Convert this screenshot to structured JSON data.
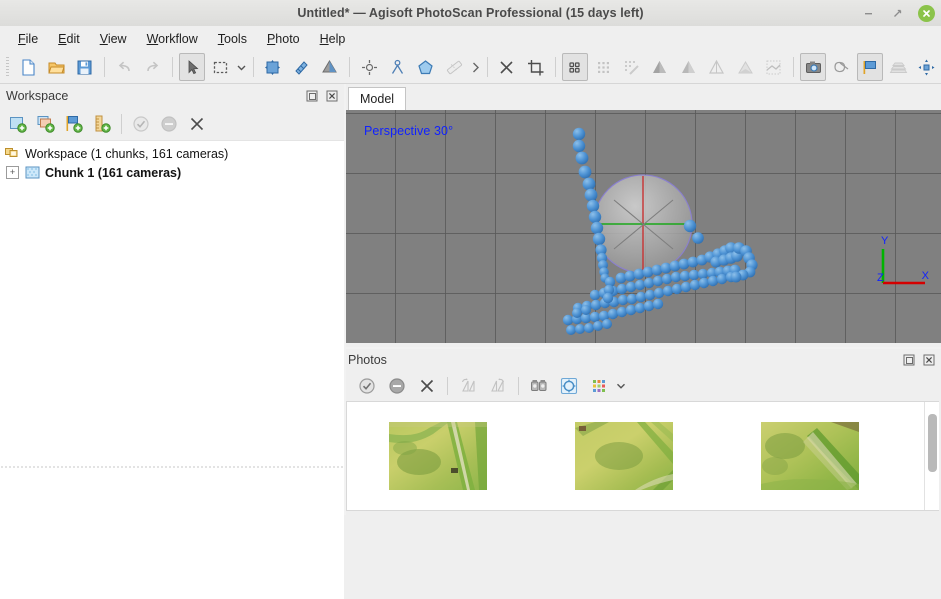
{
  "window": {
    "title": "Untitled* — Agisoft PhotoScan Professional (15 days left)",
    "minimize_label": "–",
    "restore_label": "⇱",
    "close_label": "×",
    "close_color": "#8bc34a"
  },
  "menubar": {
    "items": [
      {
        "label": "File",
        "accel": "F"
      },
      {
        "label": "Edit",
        "accel": "E"
      },
      {
        "label": "View",
        "accel": "V"
      },
      {
        "label": "Workflow",
        "accel": "W"
      },
      {
        "label": "Tools",
        "accel": "T"
      },
      {
        "label": "Photo",
        "accel": "P"
      },
      {
        "label": "Help",
        "accel": "H"
      }
    ]
  },
  "toolbar": {
    "groups": [
      {
        "name": "file",
        "buttons": [
          {
            "icon": "new-document-icon",
            "label": "New",
            "state": "enabled"
          },
          {
            "icon": "open-folder-icon",
            "label": "Open",
            "state": "enabled"
          },
          {
            "icon": "save-disk-icon",
            "label": "Save",
            "state": "enabled"
          }
        ]
      },
      {
        "name": "history",
        "buttons": [
          {
            "icon": "undo-arrow-icon",
            "label": "Undo",
            "state": "disabled"
          },
          {
            "icon": "redo-arrow-icon",
            "label": "Redo",
            "state": "disabled"
          }
        ]
      },
      {
        "name": "selection",
        "buttons": [
          {
            "icon": "cursor-arrow-icon",
            "label": "Navigation",
            "state": "active"
          },
          {
            "icon": "rectangle-selection-icon",
            "label": "Rectangle Selection",
            "state": "enabled"
          },
          {
            "icon": "chevron-down-icon",
            "label": "Selection Tools",
            "state": "enabled"
          }
        ]
      },
      {
        "name": "transform",
        "buttons": [
          {
            "icon": "move-object-icon",
            "label": "Move Object",
            "state": "enabled"
          },
          {
            "icon": "rotate-object-icon",
            "label": "Rotate Object",
            "state": "enabled"
          },
          {
            "icon": "scale-object-icon",
            "label": "Scale Object",
            "state": "enabled"
          }
        ]
      },
      {
        "name": "markers",
        "buttons": [
          {
            "icon": "add-point-icon",
            "label": "Add Point",
            "state": "enabled"
          },
          {
            "icon": "add-marker-icon",
            "label": "Add Marker",
            "state": "enabled"
          },
          {
            "icon": "add-shape-icon",
            "label": "Add Shape",
            "state": "enabled"
          },
          {
            "icon": "ruler-measure-icon",
            "label": "Measure",
            "state": "disabled"
          },
          {
            "icon": "chevron-right-icon",
            "label": "More Tools",
            "state": "enabled"
          }
        ]
      },
      {
        "name": "edit",
        "buttons": [
          {
            "icon": "delete-x-icon",
            "label": "Delete Selection",
            "state": "enabled"
          },
          {
            "icon": "crop-selection-icon",
            "label": "Crop Selection",
            "state": "enabled"
          }
        ]
      },
      {
        "name": "view-modes",
        "buttons": [
          {
            "icon": "point-cloud-icon",
            "label": "Point Cloud",
            "state": "active"
          },
          {
            "icon": "dense-cloud-icon",
            "label": "Dense Cloud",
            "state": "disabled"
          },
          {
            "icon": "classified-cloud-icon",
            "label": "Classified Dense Cloud",
            "state": "disabled"
          },
          {
            "icon": "shaded-model-icon",
            "label": "Shaded Model",
            "state": "disabled"
          },
          {
            "icon": "solid-model-icon",
            "label": "Solid Model",
            "state": "disabled"
          },
          {
            "icon": "wireframe-model-icon",
            "label": "Wireframe Model",
            "state": "disabled"
          },
          {
            "icon": "textured-model-icon",
            "label": "Textured Model",
            "state": "disabled"
          },
          {
            "icon": "dem-model-icon",
            "label": "DEM",
            "state": "disabled"
          }
        ]
      },
      {
        "name": "display",
        "buttons": [
          {
            "icon": "show-cameras-icon",
            "label": "Show Cameras",
            "state": "active"
          },
          {
            "icon": "show-regions-icon",
            "label": "Show Region",
            "state": "enabled"
          },
          {
            "icon": "show-markers-flag-icon",
            "label": "Show Markers",
            "state": "active"
          },
          {
            "icon": "show-tiepoints-icon",
            "label": "Show Tie Points",
            "state": "disabled"
          },
          {
            "icon": "reset-view-icon",
            "label": "Reset View",
            "state": "enabled"
          }
        ]
      }
    ]
  },
  "workspace": {
    "title": "Workspace",
    "float_label": "⧉",
    "close_label": "✕",
    "tools": [
      {
        "icon": "add-chunk-icon",
        "label": "Add Chunk",
        "state": "enabled"
      },
      {
        "icon": "add-photos-icon",
        "label": "Add Photos",
        "state": "enabled"
      },
      {
        "icon": "add-markers-icon",
        "label": "Add Markers",
        "state": "enabled"
      },
      {
        "icon": "add-scalebar-icon",
        "label": "Add Scale Bar",
        "state": "enabled"
      },
      {
        "icon": "enable-check-icon",
        "label": "Enable",
        "state": "disabled"
      },
      {
        "icon": "disable-minus-icon",
        "label": "Disable",
        "state": "disabled"
      },
      {
        "icon": "remove-items-icon",
        "label": "Remove Items",
        "state": "enabled"
      }
    ],
    "tree": [
      {
        "label": "Workspace (1 chunks, 161 cameras)",
        "icon": "workspace-root-icon",
        "bold": false,
        "expander": null
      },
      {
        "label": "Chunk 1 (161 cameras)",
        "icon": "chunk-icon",
        "bold": true,
        "expander": "+"
      }
    ]
  },
  "model_view": {
    "tab_label": "Model",
    "projection_label": "Perspective 30°",
    "projection_color": "#1022ff",
    "background_color": "#808080",
    "axes": [
      {
        "name": "X",
        "color": "#d40000"
      },
      {
        "name": "Y",
        "color": "#00b400"
      },
      {
        "name": "Z",
        "color": "#1022ff"
      }
    ]
  },
  "photos_panel": {
    "title": "Photos",
    "float_label": "⧉",
    "close_label": "✕",
    "tools": [
      {
        "icon": "enable-check-icon",
        "label": "Enable Photos",
        "state": "enabled"
      },
      {
        "icon": "disable-minus-icon",
        "label": "Disable Photos",
        "state": "enabled"
      },
      {
        "icon": "remove-photos-icon",
        "label": "Remove Photos",
        "state": "enabled"
      },
      {
        "icon": "rotate-left-icon",
        "label": "Rotate Left",
        "state": "disabled"
      },
      {
        "icon": "rotate-right-icon",
        "label": "Rotate Right",
        "state": "disabled"
      },
      {
        "icon": "estimate-quality-icon",
        "label": "Estimate Image Quality",
        "state": "enabled"
      },
      {
        "icon": "reset-filter-icon",
        "label": "Reset Filter",
        "state": "enabled"
      },
      {
        "icon": "thumbnail-size-icon",
        "label": "Thumbnail Size",
        "state": "enabled"
      },
      {
        "icon": "chevron-down-icon",
        "label": "More",
        "state": "enabled"
      }
    ],
    "thumbnails": [
      {
        "name": "aerial-photo-1"
      },
      {
        "name": "aerial-photo-2"
      },
      {
        "name": "aerial-photo-3"
      }
    ]
  }
}
